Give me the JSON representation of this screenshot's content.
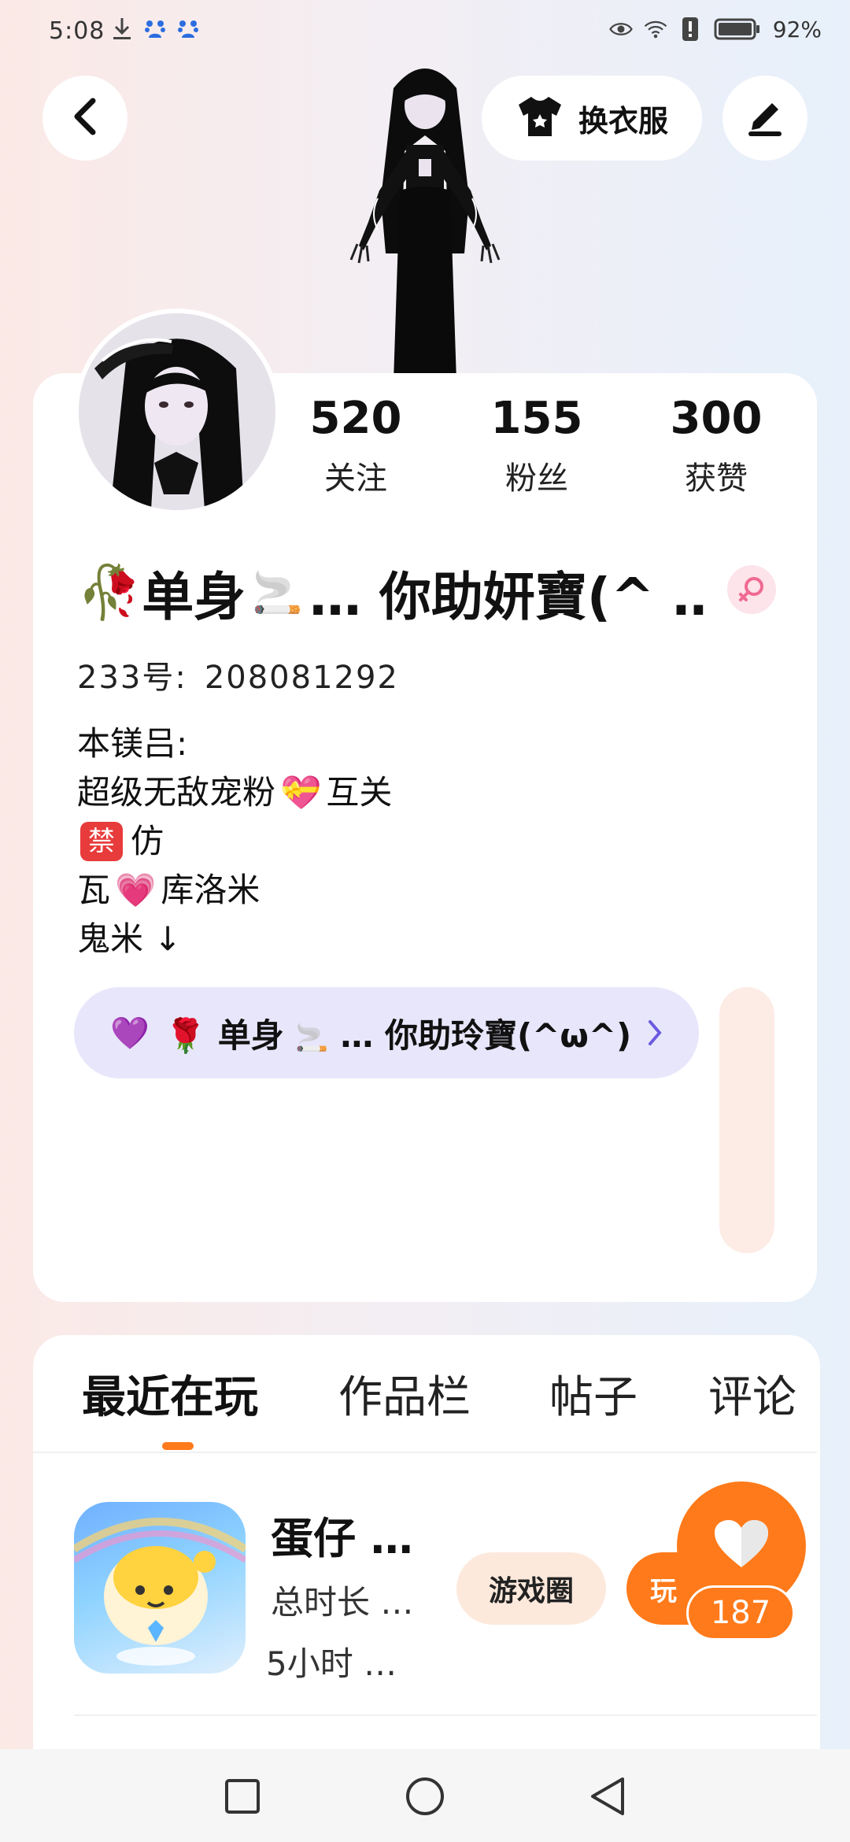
{
  "status_bar": {
    "time": "5:08",
    "battery": "92%",
    "icons": [
      "download-icon",
      "baidu-icon",
      "baidu-icon",
      "eye-icon",
      "wifi-icon",
      "alert-icon",
      "battery-icon"
    ]
  },
  "header": {
    "outfit_label": "换衣服",
    "icons": {
      "back": "chevron-left-icon",
      "outfit": "tshirt-icon",
      "edit": "pen-icon"
    }
  },
  "stats": [
    {
      "value": "520",
      "label": "关注"
    },
    {
      "value": "155",
      "label": "粉丝"
    },
    {
      "value": "300",
      "label": "获赞"
    }
  ],
  "profile": {
    "nickname_prefix": "🥀",
    "nickname_a": "单身",
    "nickname_b": "🚬",
    "nickname_c": "… 你助妍寶(^ …",
    "gender": "female",
    "id_label": "233号:",
    "id_value": "208081292",
    "bio": {
      "line1": "本镁吕:",
      "line2a": "超级无敌宠粉",
      "line2b": "💝",
      "line2c": "互关",
      "line3a": "禁",
      "line3b": "仿",
      "line4a": "瓦",
      "line4b": "💗",
      "line4c": "库洛米",
      "line5": "鬼米 ↓"
    }
  },
  "group": {
    "heart": "💜",
    "rose": "🌹",
    "name_a": "单身",
    "cig": "🚬",
    "name_b": "… 你助玲寶(^ω^)"
  },
  "tabs": [
    {
      "label": "最近在玩",
      "active": true
    },
    {
      "label": "作品栏",
      "active": false
    },
    {
      "label": "帖子",
      "active": false
    },
    {
      "label": "评论",
      "active": false
    }
  ],
  "game": {
    "title": "蛋仔 …",
    "meta1": "总时长 …",
    "meta2": "5小时 …",
    "circle_label": "游戏圈",
    "play_label": "玩",
    "like_count": "187"
  },
  "colors": {
    "accent": "#ff7a1a",
    "pill_bg": "#e8e6fb",
    "gender_pink": "#f06a93",
    "ban_red": "#e83b3b"
  }
}
